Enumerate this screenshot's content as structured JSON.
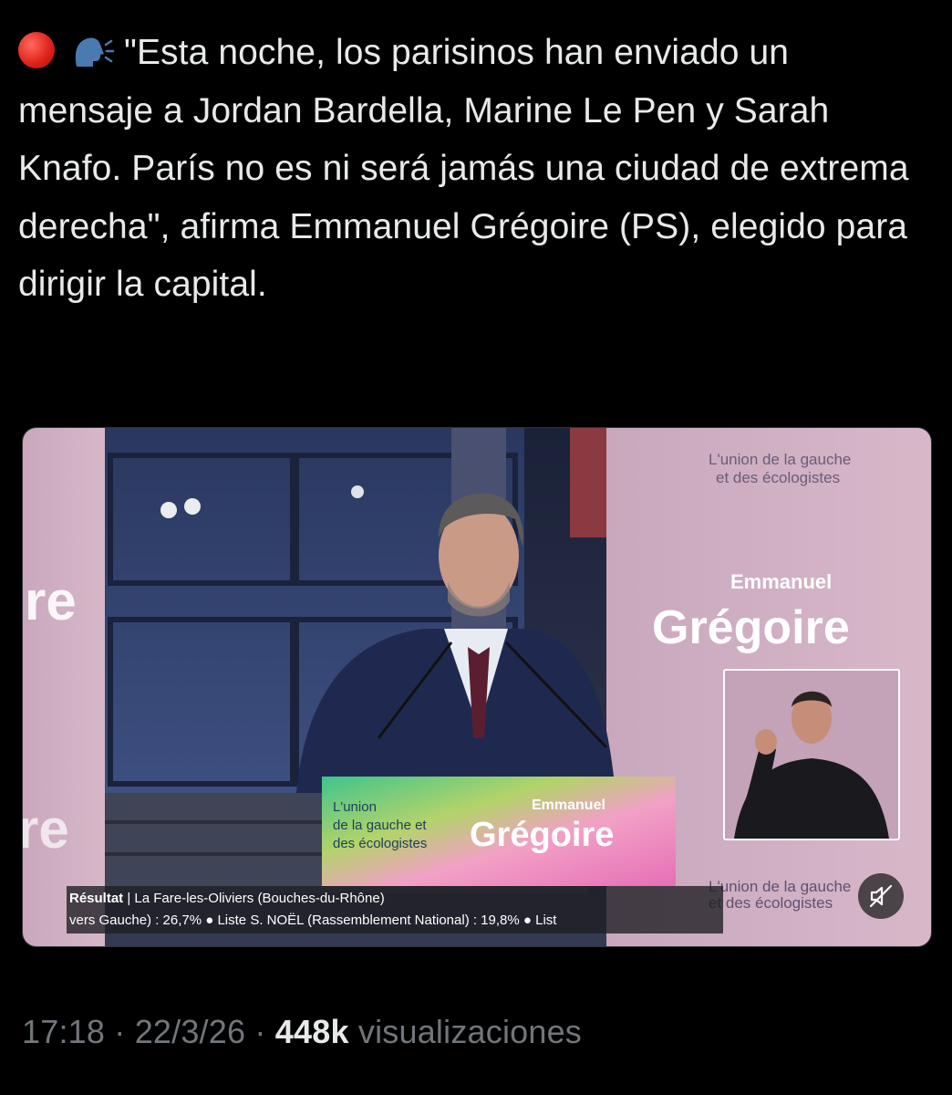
{
  "tweet": {
    "text": "\"Esta noche, los parisinos han enviado un mensaje a Jordan Bardella, Marine Le Pen y Sarah Knafo. París no es ni será jamás una ciudad de extrema derecha\", afirma Emmanuel Grégoire (PS), elegido para dirigir la capital.",
    "emojis": [
      "red-circle-icon",
      "speaking-head-icon"
    ]
  },
  "media": {
    "podium": {
      "slogan_line1": "L'union",
      "slogan_line2": "de la gauche et",
      "slogan_line3": "des écologistes",
      "first_name": "Emmanuel",
      "last_name": "Grégoire"
    },
    "backdrop": {
      "slogan_line1": "L'union de la gauche",
      "slogan_line2": "et des écologistes",
      "first_name": "Emmanuel",
      "last_name": "Grégoire",
      "lower_slogan_line1": "L'union de la gauche",
      "lower_slogan_line2": "et des écologistes"
    },
    "ticker": {
      "label": "Résultat",
      "line1": " | La Fare-les-Oliviers (Bouches-du-Rhône)",
      "line2": "vers Gauche) : 26,7% ● Liste S. NOËL (Rassemblement National) : 19,8% ● List"
    },
    "mute_button": "mute-icon"
  },
  "meta": {
    "time": "17:18",
    "sep1": " · ",
    "date": "22/3/26",
    "sep2": " · ",
    "views": "448k",
    "views_label": " visualizaciones"
  }
}
